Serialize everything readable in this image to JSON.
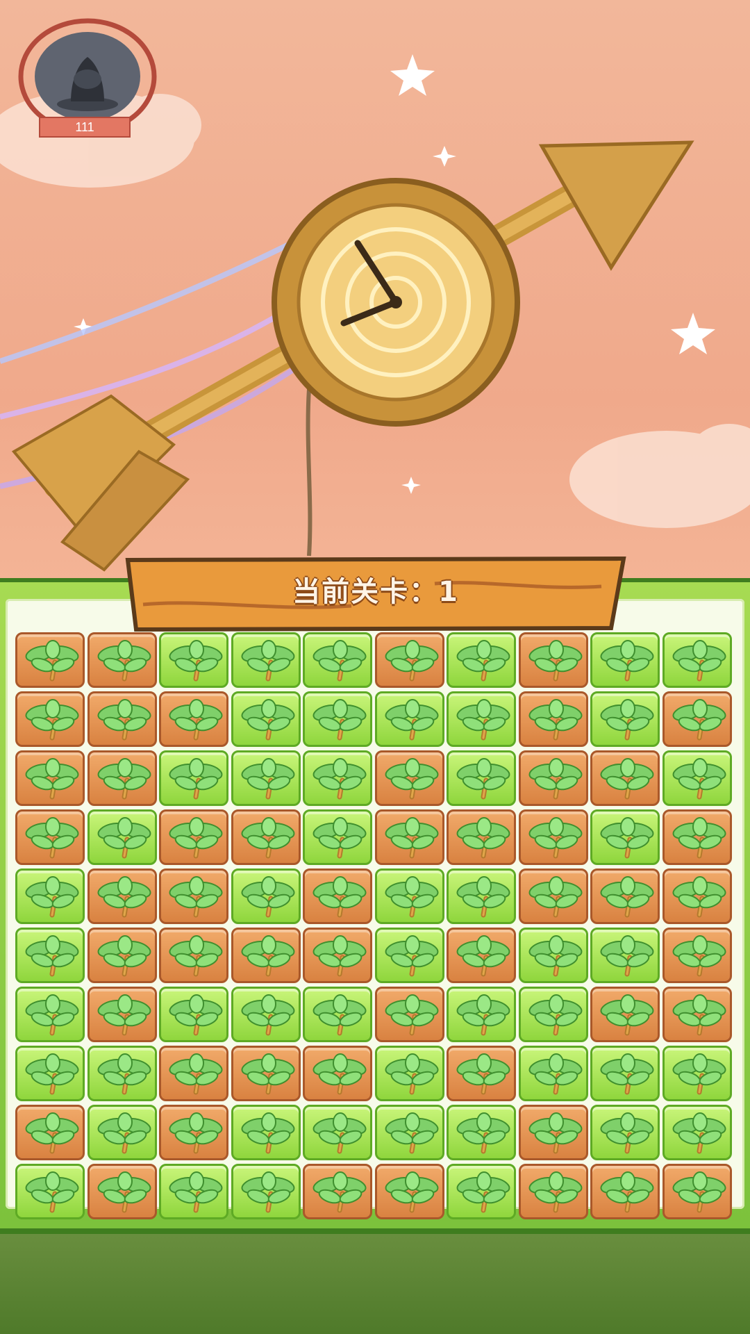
{
  "player": {
    "level_number": "111",
    "avatar_icon": "dark-rock-avatar-icon"
  },
  "board": {
    "level_label": "当前关卡：1",
    "tile_icon": "leaf-sprout-icon",
    "rows": [
      [
        "brown",
        "brown",
        "green",
        "green",
        "green",
        "brown",
        "green",
        "brown",
        "green",
        "green"
      ],
      [
        "brown",
        "brown",
        "brown",
        "green",
        "green",
        "green",
        "green",
        "brown",
        "green",
        "brown"
      ],
      [
        "brown",
        "brown",
        "green",
        "green",
        "green",
        "brown",
        "green",
        "brown",
        "brown",
        "green"
      ],
      [
        "brown",
        "green",
        "brown",
        "brown",
        "green",
        "brown",
        "brown",
        "brown",
        "green",
        "brown"
      ],
      [
        "green",
        "brown",
        "brown",
        "green",
        "brown",
        "green",
        "green",
        "brown",
        "brown",
        "brown"
      ],
      [
        "green",
        "brown",
        "brown",
        "brown",
        "brown",
        "green",
        "brown",
        "green",
        "green",
        "brown"
      ],
      [
        "green",
        "brown",
        "green",
        "green",
        "green",
        "brown",
        "green",
        "green",
        "brown",
        "brown"
      ],
      [
        "green",
        "green",
        "brown",
        "brown",
        "brown",
        "green",
        "brown",
        "green",
        "green",
        "green"
      ],
      [
        "brown",
        "green",
        "brown",
        "green",
        "green",
        "green",
        "green",
        "brown",
        "green",
        "green"
      ],
      [
        "green",
        "brown",
        "green",
        "green",
        "brown",
        "brown",
        "green",
        "brown",
        "brown",
        "brown"
      ]
    ]
  },
  "colors": {
    "brown_tile": "#d98241",
    "green_tile": "#8fd63d",
    "board_frame": "#7cc23c",
    "sky": "#f0a98b"
  }
}
